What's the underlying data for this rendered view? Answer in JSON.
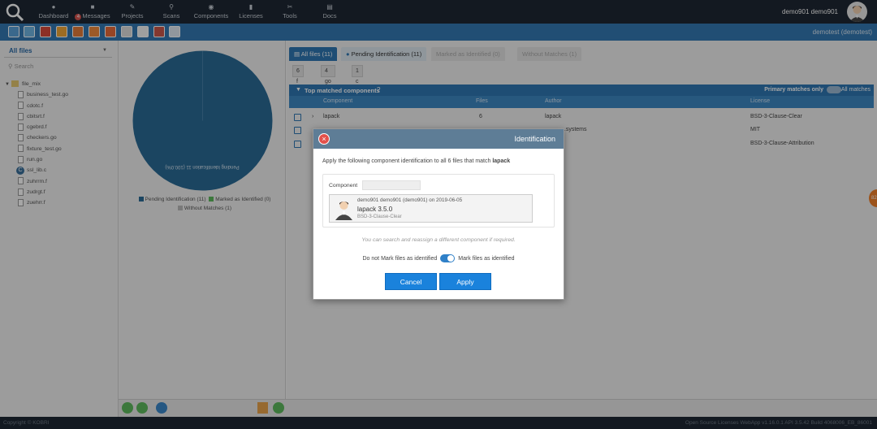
{
  "nav": {
    "items": [
      {
        "label": "Dashboard",
        "icon": "dashboard-icon"
      },
      {
        "label": "Messages",
        "icon": "messages-icon",
        "badge": "4"
      },
      {
        "label": "Projects",
        "icon": "projects-icon"
      },
      {
        "label": "Scans",
        "icon": "scans-icon"
      },
      {
        "label": "Components",
        "icon": "components-icon"
      },
      {
        "label": "Licenses",
        "icon": "licenses-icon"
      },
      {
        "label": "Tools",
        "icon": "tools-icon"
      },
      {
        "label": "Docs",
        "icon": "docs-icon"
      }
    ],
    "username": "demo901 demo901"
  },
  "toolbar": {
    "project": "demotest (demotest)"
  },
  "left": {
    "selector": "All files",
    "search_placeholder": "Search",
    "tree": [
      {
        "name": "file_mix",
        "type": "folder"
      },
      {
        "name": "business_test.go",
        "type": "file"
      },
      {
        "name": "cdotc.f",
        "type": "file"
      },
      {
        "name": "cbitsrt.f",
        "type": "file"
      },
      {
        "name": "cgebrd.f",
        "type": "file"
      },
      {
        "name": "checkers.go",
        "type": "file"
      },
      {
        "name": "fixture_test.go",
        "type": "file"
      },
      {
        "name": "run.go",
        "type": "file"
      },
      {
        "name": "ssl_lib.c",
        "type": "file-special"
      },
      {
        "name": "zuhrrm.f",
        "type": "file"
      },
      {
        "name": "zudrgt.f",
        "type": "file"
      },
      {
        "name": "zuehrr.f",
        "type": "file"
      }
    ]
  },
  "mid": {
    "pie_label": "Pending Identification 11 (100.0%)",
    "legend": [
      "Pending Identification (11)",
      "Marked as Identified (0)",
      "Without Matches (1)"
    ]
  },
  "right": {
    "tabs": [
      "All files (11)",
      "Pending Identification (11)",
      "Marked as Identified (0)",
      "Without Matches (1)"
    ],
    "chips": [
      "6 f",
      "4 go",
      "1 c"
    ],
    "section_title": "Top matched components",
    "primary_label": "Primary matches only",
    "all_matches_label": "All matches",
    "columns": [
      "Component",
      "Files",
      "Author",
      "License"
    ],
    "rows": [
      {
        "component": "lapack",
        "files": "6",
        "author": "lapack",
        "license": "BSD-3-Clause-Clear"
      },
      {
        "component": "",
        "files": "",
        "author": "...systems",
        "license": "MIT"
      },
      {
        "component": "",
        "files": "",
        "author": "",
        "license": "BSD-3-Clause-Attribution"
      }
    ]
  },
  "status": {
    "left": "Copyright © KOBRI",
    "right": "Open Source Licenses  WebApp v1.16.0.1  API 3.5.42 Build 4068006_EB_86001"
  },
  "modal": {
    "title": "Identification",
    "text_prefix": "Apply the following component identification to all 6 files that match ",
    "text_component": "lapack",
    "component_label": "Component",
    "card_line1": "demo901 demo901 (demo901) on 2019-06-05",
    "card_name": "lapack 3.5.0",
    "card_license": "BSD-3-Clause-Clear",
    "note": "You can search and reassign a different component if required.",
    "toggle_left": "Do not Mark files as identified",
    "toggle_right": "Mark files as identified",
    "cancel": "Cancel",
    "apply": "Apply"
  },
  "colors": {
    "accent": "#2f77b3",
    "topbar": "#1e2733",
    "pie": "#2a6a95",
    "button": "#1a82dc"
  },
  "orange_badge": "82"
}
